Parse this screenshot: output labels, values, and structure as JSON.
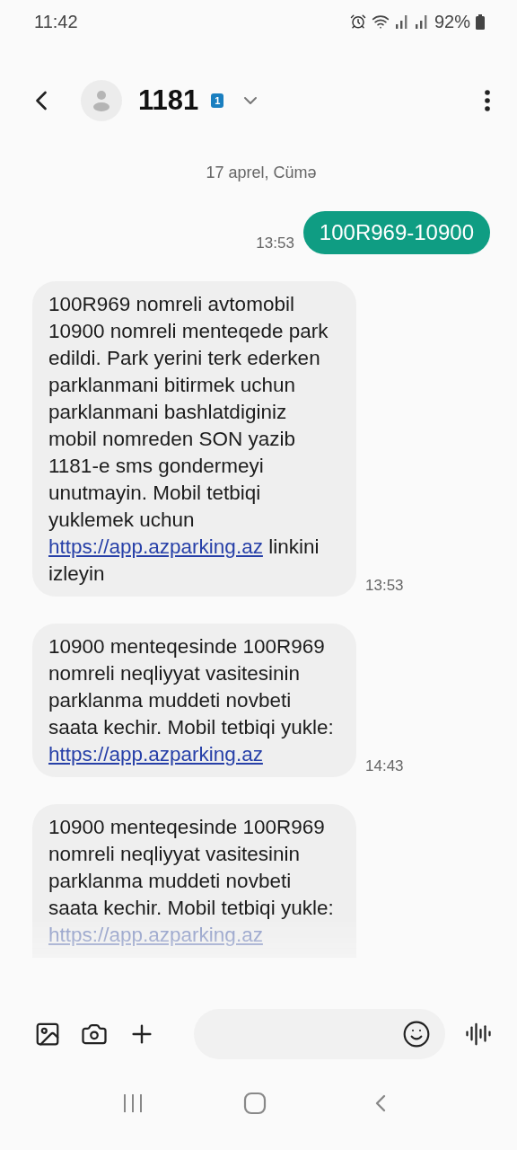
{
  "status_bar": {
    "time": "11:42",
    "battery": "92%"
  },
  "header": {
    "title": "1181",
    "sim_badge": "1"
  },
  "date_divider": "17 aprel, Cümə",
  "messages": [
    {
      "kind": "sent",
      "text": "100R969-10900",
      "time": "13:53",
      "faded": false
    },
    {
      "kind": "received",
      "text": "100R969 nomreli avtomobil 10900 nomreli menteqede park edildi. Park yerini terk ederken parklanmani bitirmek uchun parklanmani bashlatdiginiz mobil nomreden SON yazib 1181-e sms gondermeyi unutmayin. Mobil tetbiqi yuklemek uchun",
      "link": "https://app.azparking.az",
      "text_after": "linkini izleyin",
      "time": "13:53",
      "faded": false
    },
    {
      "kind": "received",
      "text": "10900 menteqesinde 100R969 nomreli neqliyyat vasitesinin parklanma muddeti novbeti saata kechir. Mobil tetbiqi yukle:",
      "link": "https://app.azparking.az",
      "time": "14:43",
      "faded": false
    },
    {
      "kind": "received",
      "text": "10900 menteqesinde 100R969 nomreli neqliyyat vasitesinin parklanma muddeti novbeti saata kechir. Mobil tetbiqi yukle:",
      "link": "https://app.azparking.az",
      "faded": true
    }
  ]
}
